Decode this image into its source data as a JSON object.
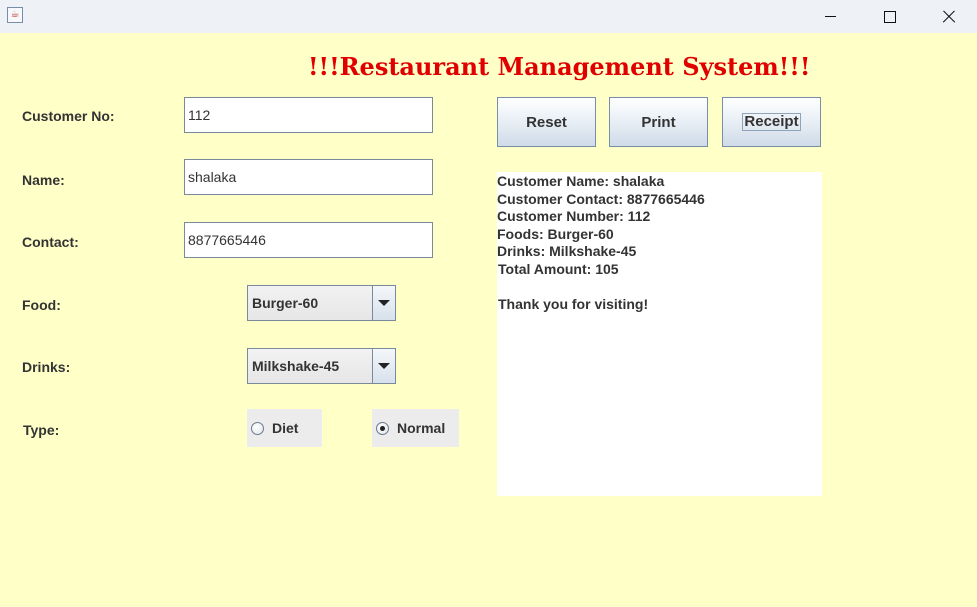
{
  "window": {
    "app_icon": "java-cup-icon",
    "minimize_icon": "minimize-icon",
    "maximize_icon": "maximize-icon",
    "close_icon": "close-icon"
  },
  "title": "!!!Restaurant Management System!!!",
  "form": {
    "customer_no": {
      "label": "Customer No:",
      "value": "112"
    },
    "name": {
      "label": "Name:",
      "value": "shalaka"
    },
    "contact": {
      "label": "Contact:",
      "value": "8877665446"
    },
    "food": {
      "label": "Food:",
      "selected": "Burger-60"
    },
    "drinks": {
      "label": "Drinks:",
      "selected": "Milkshake-45"
    },
    "type": {
      "label": "Type:",
      "options": [
        "Diet",
        "Normal"
      ],
      "selected": "Normal"
    }
  },
  "buttons": {
    "reset": "Reset",
    "print": "Print",
    "receipt": "Receipt"
  },
  "receipt": {
    "lines": [
      "Customer Name: shalaka",
      "Customer Contact: 8877665446",
      "Customer Number: 112",
      "Foods: Burger-60",
      "Drinks: Milkshake-45",
      "Total Amount: 105",
      "",
      "Thank you for visiting!"
    ]
  },
  "colors": {
    "background": "#ffffc8",
    "title": "#e00000"
  }
}
